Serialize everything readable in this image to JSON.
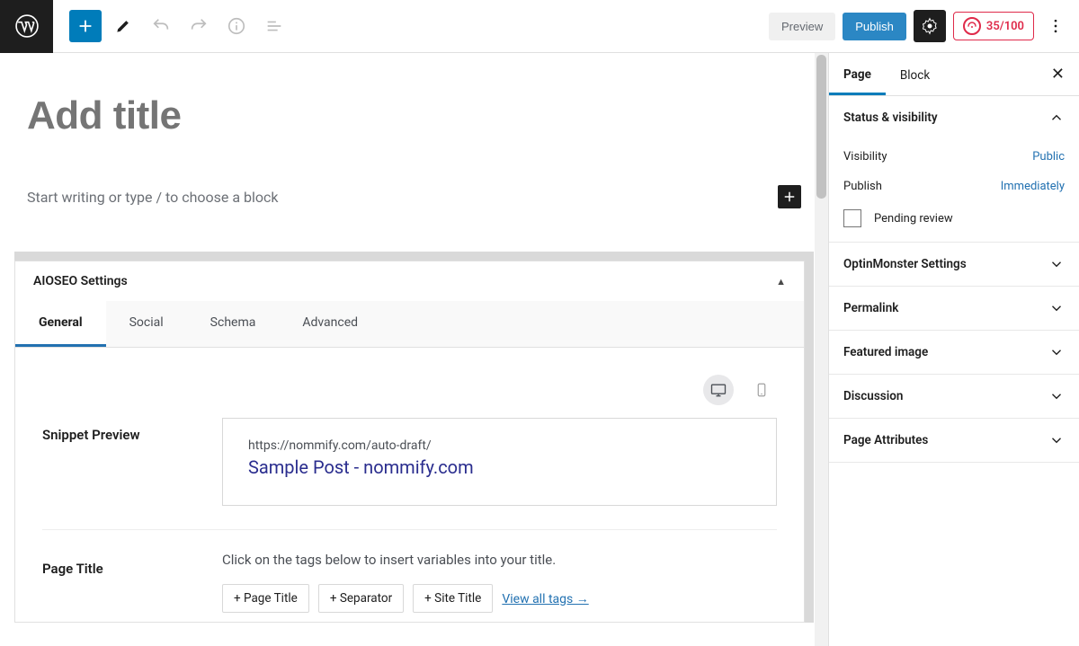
{
  "toolbar": {
    "preview_label": "Preview",
    "publish_label": "Publish",
    "score": "35/100"
  },
  "editor": {
    "title_placeholder": "Add title",
    "block_prompt": "Start writing or type / to choose a block"
  },
  "seo": {
    "panel_title": "AIOSEO Settings",
    "tabs": [
      "General",
      "Social",
      "Schema",
      "Advanced"
    ],
    "snippet_label": "Snippet Preview",
    "preview_url": "https://nommify.com/auto-draft/",
    "preview_title": "Sample Post - nommify.com",
    "page_title_label": "Page Title",
    "page_title_hint": "Click on the tags below to insert variables into your title.",
    "tag_page_title": "Page Title",
    "tag_separator": "Separator",
    "tag_site_title": "Site Title",
    "view_all": "View all tags →"
  },
  "sidebar": {
    "tabs": {
      "page": "Page",
      "block": "Block"
    },
    "status": {
      "heading": "Status & visibility",
      "visibility_label": "Visibility",
      "visibility_value": "Public",
      "publish_label": "Publish",
      "publish_value": "Immediately",
      "pending_label": "Pending review"
    },
    "sections": {
      "optin": "OptinMonster Settings",
      "permalink": "Permalink",
      "featured": "Featured image",
      "discussion": "Discussion",
      "attrs": "Page Attributes"
    }
  }
}
